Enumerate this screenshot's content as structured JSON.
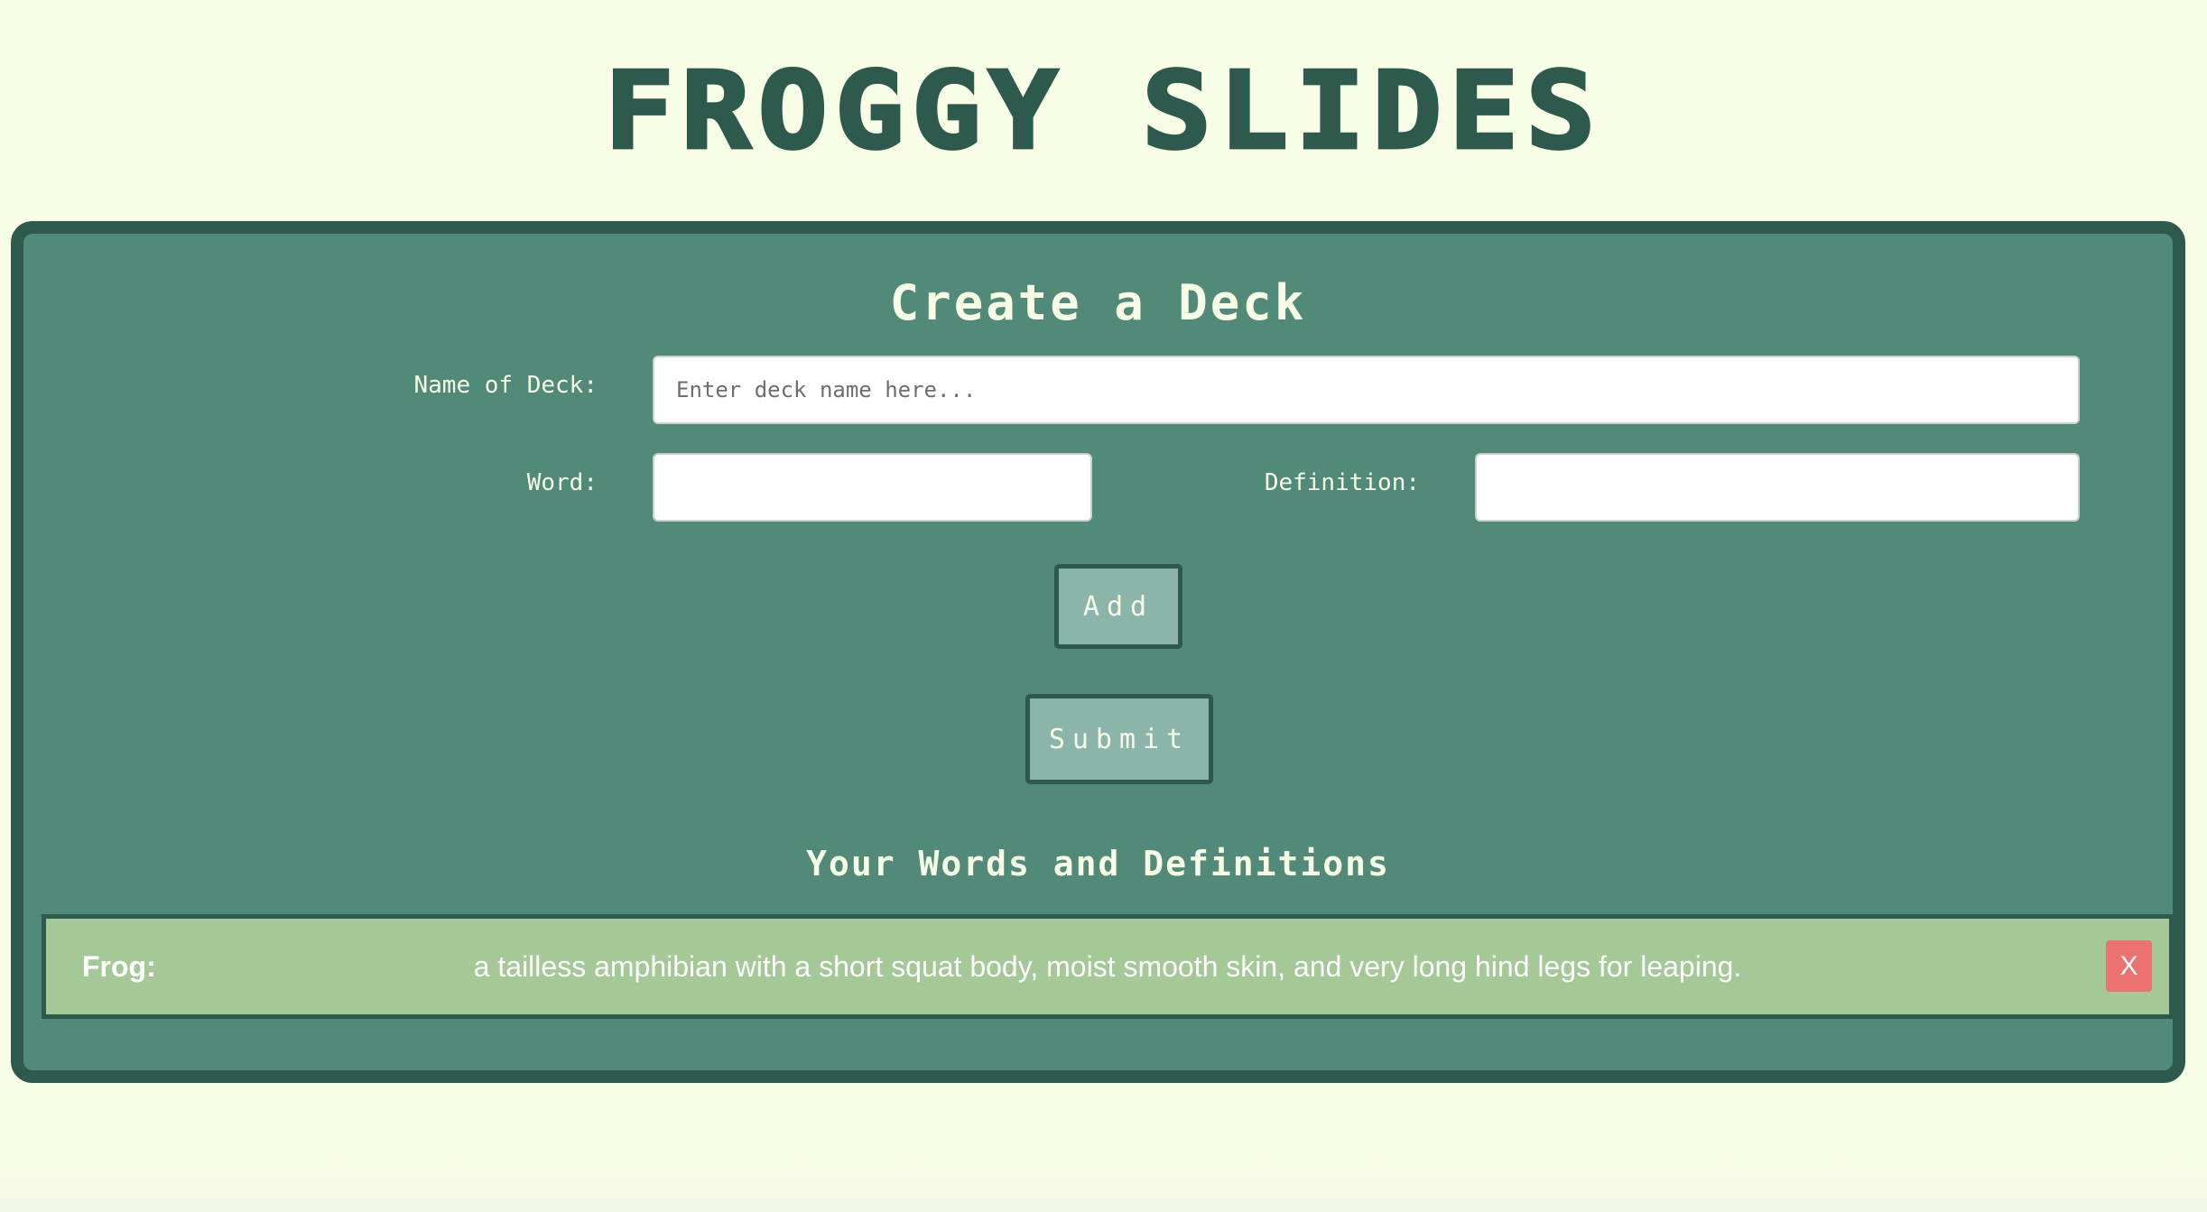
{
  "header": {
    "site_title": "FROGGY SLIDES"
  },
  "form": {
    "heading": "Create a Deck",
    "deck_name_label": "Name of Deck:",
    "deck_name_placeholder": "Enter deck name here...",
    "deck_name_value": "",
    "word_label": "Word:",
    "word_value": "",
    "definition_label": "Definition:",
    "definition_value": "",
    "add_label": "Add",
    "submit_label": "Submit"
  },
  "words_section": {
    "heading": "Your Words and Definitions",
    "items": [
      {
        "term": "Frog:",
        "definition": "a tailless amphibian with a short squat body, moist smooth skin, and very long hind legs for leaping.",
        "delete_label": "X"
      }
    ]
  },
  "colors": {
    "background": "#f8fde6",
    "panel": "#518a79",
    "panel_border": "#2e5a4e",
    "button": "#8bb5aa",
    "word_row": "#a4c896",
    "delete": "#ec7272"
  }
}
